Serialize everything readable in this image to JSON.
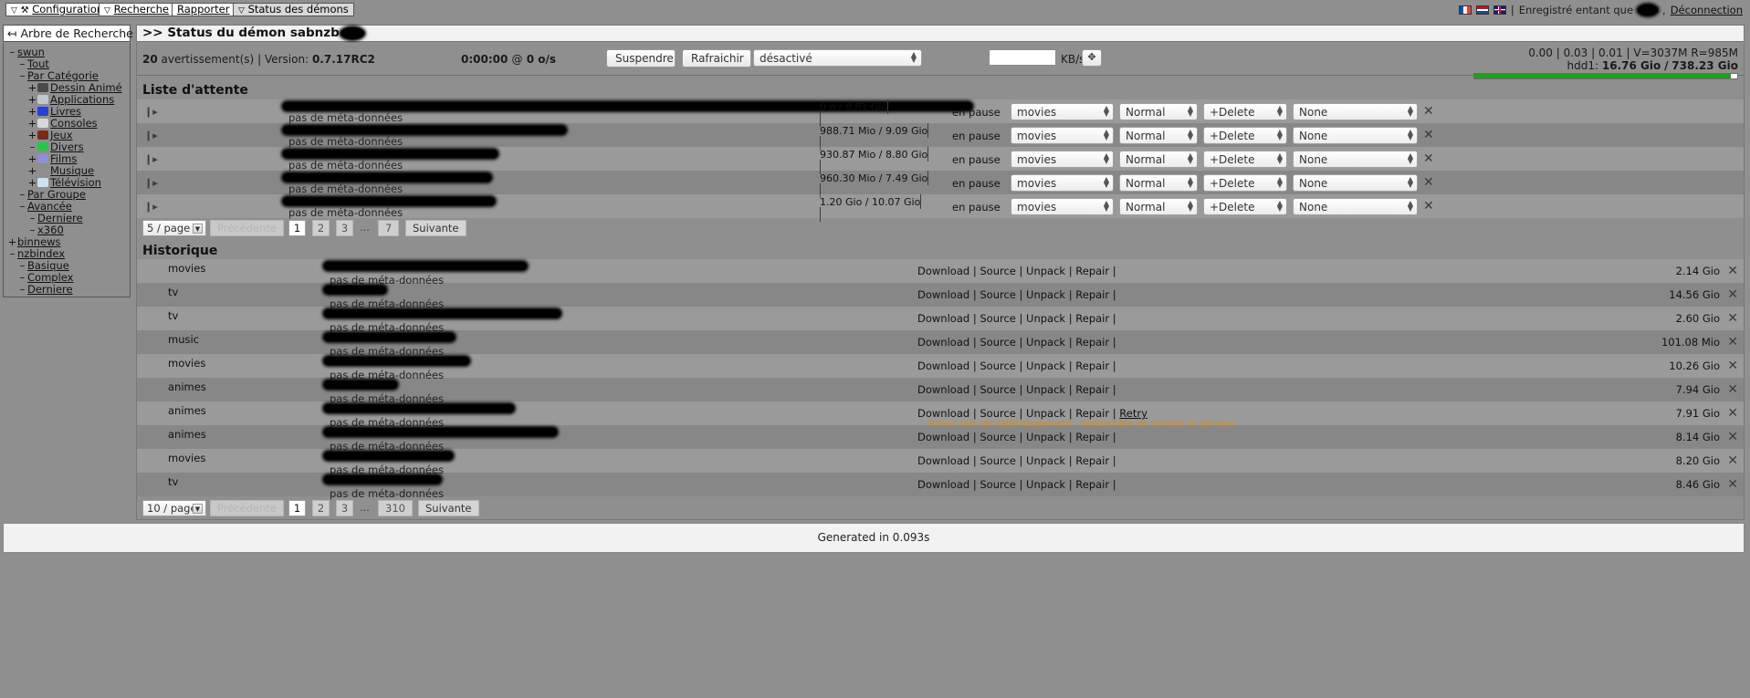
{
  "topbar": {
    "tabs": [
      {
        "id": "config",
        "label": "Configuration",
        "caret": "▽",
        "icon": "wrench-icon"
      },
      {
        "id": "search",
        "label": "Recherche",
        "caret": "▽",
        "icon": null
      },
      {
        "id": "report",
        "label": "Rapporter",
        "caret": "",
        "icon": null
      },
      {
        "id": "daemon",
        "label": "Status des démons",
        "caret": "▽",
        "icon": null
      }
    ],
    "flags": [
      "flag-fr",
      "flag-nl",
      "flag-gb"
    ],
    "separator": "|",
    "logged_in_as": "Enregistré entant que",
    "username_redacted": "",
    "comma": ",",
    "logout": "Déconnection"
  },
  "sidebar": {
    "header": "Arbre de Recherche",
    "back_icon": "↤",
    "items": [
      {
        "toggle": "–",
        "label": "swun",
        "indent": 0,
        "icon": null
      },
      {
        "toggle": "–",
        "label": "Tout",
        "indent": 1,
        "icon": null
      },
      {
        "toggle": "–",
        "label": "Par Catégorie",
        "indent": 1,
        "icon": null
      },
      {
        "toggle": "+",
        "label": "Dessin Animé",
        "indent": 2,
        "icon": "anime-icon",
        "color": "#4a4a4a"
      },
      {
        "toggle": "+",
        "label": "Applications",
        "indent": 2,
        "icon": "applications-icon",
        "color": "#bfc7cf"
      },
      {
        "toggle": "+",
        "label": "Livres",
        "indent": 2,
        "icon": "books-icon",
        "color": "#2b3fd0"
      },
      {
        "toggle": "+",
        "label": "Consoles",
        "indent": 2,
        "icon": "consoles-icon",
        "color": "#d8d8d8"
      },
      {
        "toggle": "+",
        "label": "Jeux",
        "indent": 2,
        "icon": "games-icon",
        "color": "#7a2b18"
      },
      {
        "toggle": "–",
        "label": "Divers",
        "indent": 2,
        "icon": "misc-icon",
        "color": "#2bc44a"
      },
      {
        "toggle": "+",
        "label": "Films",
        "indent": 2,
        "icon": "movies-icon",
        "color": "#8f8fd8"
      },
      {
        "toggle": "+",
        "label": "Musique",
        "indent": 2,
        "icon": "music-icon",
        "color": "#8f8f8f"
      },
      {
        "toggle": "+",
        "label": "Télévision",
        "indent": 2,
        "icon": "tv-icon",
        "color": "#cfe0ef"
      },
      {
        "toggle": "–",
        "label": "Par Groupe",
        "indent": 1,
        "icon": null
      },
      {
        "toggle": "–",
        "label": "Avancée",
        "indent": 1,
        "icon": null
      },
      {
        "toggle": "–",
        "label": "Derniere",
        "indent": 2,
        "icon": null
      },
      {
        "toggle": "–",
        "label": "x360",
        "indent": 2,
        "icon": null
      },
      {
        "toggle": "+",
        "label": "binnews",
        "indent": 0,
        "icon": null
      },
      {
        "toggle": "–",
        "label": "nzbindex",
        "indent": 0,
        "icon": null
      },
      {
        "toggle": "–",
        "label": "Basique",
        "indent": 1,
        "icon": null
      },
      {
        "toggle": "–",
        "label": "Complex",
        "indent": 1,
        "icon": null
      },
      {
        "toggle": "–",
        "label": "Derniere",
        "indent": 1,
        "icon": null
      }
    ]
  },
  "main": {
    "header": ">> Status du démon sabnzb",
    "header_redacted": ""
  },
  "status": {
    "warnings_count": "20",
    "warnings_label": "avertissement(s)",
    "sep": "|",
    "version_label": "Version:",
    "version_value": "0.7.17RC2",
    "eta": "0:00:00",
    "at": "@",
    "speed": "0 o/s",
    "pause_button": "Suspendre",
    "refresh_button": "Rafraichir",
    "shutdown_select": "désactivé",
    "speed_input_value": "",
    "speed_unit": "KB/s",
    "speed_set_icon": "✥",
    "loadavg": "0.00 | 0.03 | 0.01 | V=3037M R=985M",
    "hdd_label": "hdd1:",
    "hdd_free": "16.76 Gio",
    "hdd_slash": "/",
    "hdd_total": "738.23 Gio",
    "disk_used_pct": 97.7
  },
  "queue": {
    "title": "Liste d'attente",
    "meta_text": "pas de méta-données",
    "rows": [
      {
        "title_width": 755,
        "progress_label": "0 o / 8.81 Gio",
        "pct": 0,
        "status": "en pause",
        "category": "movies",
        "priority": "Normal",
        "postproc": "+Delete",
        "script": "None"
      },
      {
        "title_width": 310,
        "progress_label": "988.71 Mio / 9.09 Gio",
        "pct": 10.6,
        "status": "en pause",
        "category": "movies",
        "priority": "Normal",
        "postproc": "+Delete",
        "script": "None"
      },
      {
        "title_width": 235,
        "progress_label": "930.87 Mio / 8.80 Gio",
        "pct": 10.3,
        "status": "en pause",
        "category": "movies",
        "priority": "Normal",
        "postproc": "+Delete",
        "script": "None"
      },
      {
        "title_width": 228,
        "progress_label": "960.30 Mio / 7.49 Gio",
        "pct": 12.5,
        "status": "en pause",
        "category": "movies",
        "priority": "Normal",
        "postproc": "+Delete",
        "script": "None"
      },
      {
        "title_width": 232,
        "progress_label": "1.20 Gio / 10.07 Gio",
        "pct": 11.9,
        "status": "en pause",
        "category": "movies",
        "priority": "Normal",
        "postproc": "+Delete",
        "script": "None"
      }
    ],
    "pager": {
      "per_page": "5 / page",
      "prev": "Précédente",
      "pages": [
        "1",
        "2",
        "3"
      ],
      "ellipsis": "...",
      "last": "7",
      "next": "Suivante",
      "current": "1"
    }
  },
  "history": {
    "title": "Historique",
    "meta_text": "pas de méta-données",
    "actions": [
      "Download",
      "Source",
      "Unpack",
      "Repair"
    ],
    "retry_label": "Retry",
    "rows": [
      {
        "category": "movies",
        "title_width": 222,
        "size": "2.14 Gio",
        "has_retry": false,
        "error": null
      },
      {
        "category": "tv",
        "title_width": 68,
        "size": "14.56 Gio",
        "has_retry": false,
        "error": null
      },
      {
        "category": "tv",
        "title_width": 259,
        "size": "2.60 Gio",
        "has_retry": false,
        "error": null
      },
      {
        "category": "music",
        "title_width": 143,
        "size": "101.08 Mio",
        "has_retry": false,
        "error": null
      },
      {
        "category": "movies",
        "title_width": 159,
        "size": "10.26 Gio",
        "has_retry": false,
        "error": null
      },
      {
        "category": "animes",
        "title_width": 80,
        "size": "7.94 Gio",
        "has_retry": false,
        "error": null
      },
      {
        "category": "animes",
        "title_width": 208,
        "size": "7.91 Gio",
        "has_retry": true,
        "error": "Erreur lors du téléchargement - Impossible de joindre le serveur"
      },
      {
        "category": "animes",
        "title_width": 255,
        "size": "8.14 Gio",
        "has_retry": false,
        "error": null
      },
      {
        "category": "movies",
        "title_width": 141,
        "size": "8.20 Gio",
        "has_retry": false,
        "error": null
      },
      {
        "category": "tv",
        "title_width": 128,
        "size": "8.46 Gio",
        "has_retry": false,
        "error": null
      }
    ],
    "pager": {
      "per_page": "10 / page",
      "prev": "Précédente",
      "pages": [
        "1",
        "2",
        "3"
      ],
      "ellipsis": "...",
      "last": "310",
      "next": "Suivante",
      "current": "1"
    }
  },
  "footer": {
    "generated": "Generated in 0.093s"
  },
  "colors": {
    "progress_green": "#11a011",
    "error_orange": "#d98a1a",
    "page_bg": "#8f8f8f"
  }
}
